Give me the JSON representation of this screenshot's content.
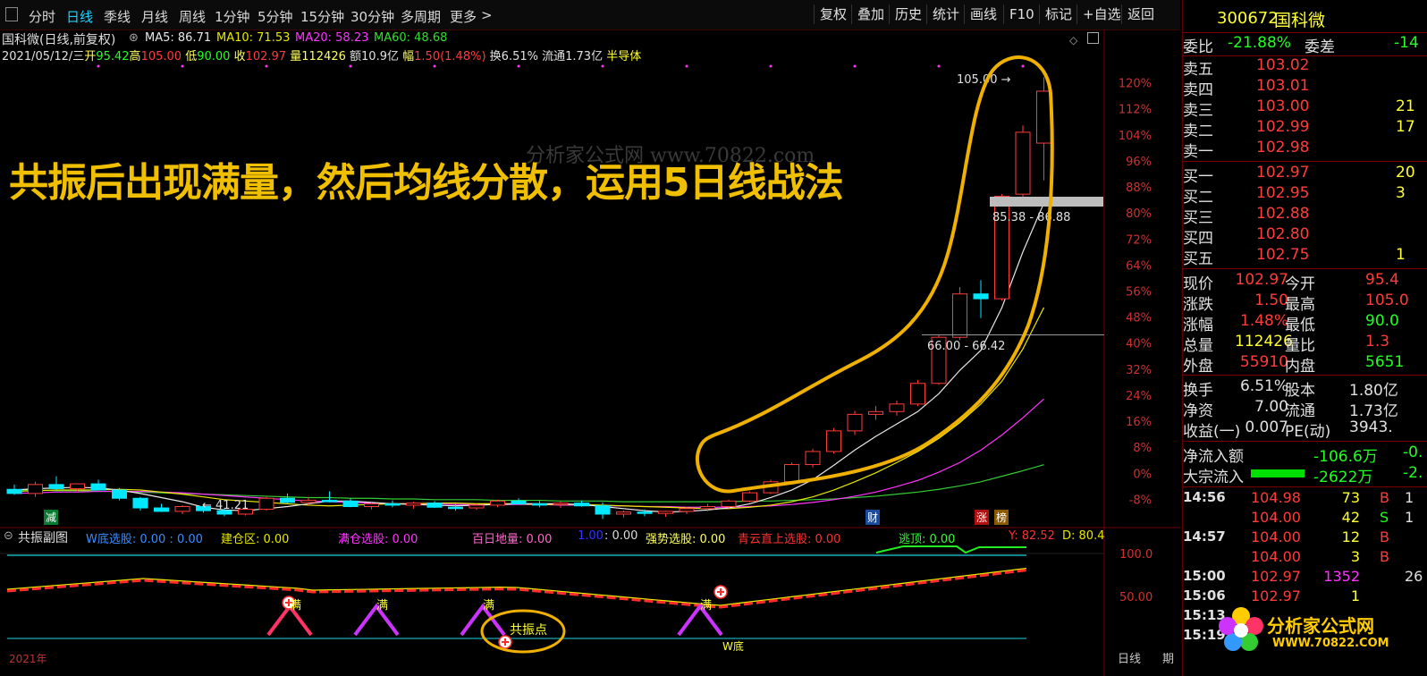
{
  "toolbar": {
    "tabs": [
      {
        "label": "分时",
        "active": false
      },
      {
        "label": "日线",
        "active": true
      },
      {
        "label": "季线",
        "active": false
      },
      {
        "label": "月线",
        "active": false
      },
      {
        "label": "周线",
        "active": false
      },
      {
        "label": "1分钟",
        "active": false
      },
      {
        "label": "5分钟",
        "active": false
      },
      {
        "label": "15分钟",
        "active": false
      },
      {
        "label": "30分钟",
        "active": false
      },
      {
        "label": "多周期",
        "active": false
      },
      {
        "label": "更多",
        "active": false
      }
    ],
    "more_arrow": ">",
    "right_buttons": [
      "复权",
      "叠加",
      "历史",
      "统计",
      "画线",
      "F10",
      "标记",
      "+自选",
      "返回"
    ]
  },
  "chart_header": {
    "name": "国科微(日线,前复权)",
    "ma5": "MA5: 86.71",
    "ma10": "MA10: 71.53",
    "ma20": "MA20: 58.23",
    "ma60": "MA60: 48.68",
    "date": "2021/05/12/三",
    "open_l": "开",
    "open": "95.42",
    "high_l": "高",
    "high": "105.00",
    "low_l": "低",
    "low": "90.00",
    "close_l": "收",
    "close": "102.97",
    "vol_l": "量",
    "vol": "112426",
    "amt": "额10.9亿",
    "chg_l": "幅",
    "chg": "1.50(1.48%)",
    "turnover": "换6.51%",
    "float": "流通1.73亿",
    "sector": "半导体"
  },
  "annotation": {
    "headline": "共振后出现满量，然后均线分散，运用5日线战法",
    "watermark": "分析家公式网 www.70822.com",
    "circle_label": "共振点"
  },
  "price_labels": {
    "high_mark": "105.00",
    "low_mark": "41.21",
    "range1": "85.38 - 86.88",
    "range2": "66.00 - 66.42"
  },
  "chart_data": {
    "type": "candlestick",
    "y_pct_ticks": [
      "120%",
      "112%",
      "104%",
      "96%",
      "88%",
      "80%",
      "72%",
      "64%",
      "56%",
      "48%",
      "40%",
      "32%",
      "24%",
      "16%",
      "8%",
      "0%",
      "-8%"
    ],
    "candles": [
      [
        45.1,
        45.8,
        44.3,
        44.5
      ],
      [
        44.5,
        46.2,
        44.0,
        45.8
      ],
      [
        45.8,
        47.0,
        45.0,
        45.2
      ],
      [
        45.2,
        46.0,
        44.8,
        45.9
      ],
      [
        45.9,
        46.5,
        45.0,
        45.0
      ],
      [
        45.0,
        45.3,
        43.5,
        43.8
      ],
      [
        43.8,
        44.0,
        42.0,
        42.4
      ],
      [
        42.4,
        43.0,
        41.8,
        41.9
      ],
      [
        41.9,
        42.8,
        41.5,
        42.6
      ],
      [
        42.6,
        43.0,
        41.7,
        42.0
      ],
      [
        42.0,
        42.3,
        41.2,
        41.5
      ],
      [
        41.5,
        42.4,
        41.3,
        42.2
      ],
      [
        42.2,
        44.0,
        42.0,
        43.8
      ],
      [
        43.8,
        44.5,
        43.0,
        43.2
      ],
      [
        43.2,
        44.0,
        42.8,
        43.5
      ],
      [
        43.5,
        44.8,
        43.2,
        43.4
      ],
      [
        43.4,
        43.8,
        42.5,
        42.6
      ],
      [
        42.6,
        43.2,
        42.2,
        43.0
      ],
      [
        43.0,
        43.5,
        42.5,
        42.8
      ],
      [
        42.8,
        43.3,
        42.3,
        43.1
      ],
      [
        43.1,
        43.4,
        42.4,
        42.5
      ],
      [
        42.5,
        43.0,
        42.0,
        42.4
      ],
      [
        42.4,
        43.0,
        42.1,
        42.8
      ],
      [
        42.8,
        43.6,
        42.5,
        43.4
      ],
      [
        43.4,
        43.8,
        42.9,
        43.0
      ],
      [
        43.0,
        43.4,
        42.5,
        42.9
      ],
      [
        42.9,
        43.3,
        42.4,
        43.1
      ],
      [
        43.1,
        43.5,
        42.6,
        42.7
      ],
      [
        42.7,
        43.2,
        40.8,
        41.5
      ],
      [
        41.5,
        42.0,
        41.0,
        41.8
      ],
      [
        41.8,
        42.2,
        41.2,
        41.6
      ],
      [
        41.6,
        42.0,
        41.1,
        41.9
      ],
      [
        41.9,
        42.5,
        41.5,
        42.3
      ],
      [
        42.3,
        43.0,
        41.9,
        42.6
      ],
      [
        42.6,
        43.6,
        42.3,
        43.4
      ],
      [
        43.4,
        44.8,
        43.2,
        44.6
      ],
      [
        44.6,
        46.5,
        44.4,
        46.2
      ],
      [
        46.2,
        49.0,
        46.0,
        48.7
      ],
      [
        48.7,
        51.0,
        48.3,
        50.6
      ],
      [
        50.6,
        54.0,
        50.3,
        53.6
      ],
      [
        53.6,
        56.5,
        53.0,
        56.0
      ],
      [
        56.0,
        57.2,
        55.2,
        56.4
      ],
      [
        56.4,
        58.0,
        55.8,
        57.5
      ],
      [
        57.5,
        61.0,
        57.2,
        60.5
      ],
      [
        60.5,
        67.5,
        60.3,
        67.2
      ],
      [
        67.2,
        74.5,
        66.8,
        73.5
      ],
      [
        73.5,
        75.5,
        70.0,
        72.8
      ],
      [
        72.8,
        88.0,
        72.5,
        87.7
      ],
      [
        88.0,
        98.0,
        87.5,
        97.0
      ],
      [
        95.42,
        105.0,
        90.0,
        102.97
      ]
    ],
    "ma5": [
      45.0,
      45.2,
      45.3,
      45.4,
      45.3,
      45.0,
      44.5,
      43.9,
      43.3,
      42.5,
      42.1,
      42.0,
      42.3,
      42.6,
      43.0,
      43.4,
      43.4,
      43.2,
      43.0,
      42.9,
      42.8,
      42.7,
      42.8,
      42.9,
      43.0,
      43.0,
      43.0,
      42.9,
      42.6,
      42.3,
      42.0,
      41.8,
      41.9,
      42.1,
      42.4,
      43.0,
      43.9,
      45.0,
      46.5,
      48.6,
      50.8,
      52.8,
      54.6,
      56.4,
      59.0,
      62.4,
      65.3,
      71.5,
      79.6,
      86.71
    ],
    "ma10": [
      44.8,
      44.9,
      45.0,
      45.0,
      45.0,
      45.1,
      45.0,
      44.7,
      44.4,
      44.0,
      43.6,
      43.4,
      43.2,
      43.0,
      42.8,
      42.7,
      42.8,
      42.9,
      43.0,
      43.0,
      43.1,
      43.1,
      43.0,
      43.0,
      43.0,
      42.9,
      42.9,
      42.9,
      42.8,
      42.7,
      42.6,
      42.5,
      42.4,
      42.3,
      42.3,
      42.5,
      42.8,
      43.3,
      44.0,
      45.0,
      46.2,
      47.5,
      49.0,
      50.6,
      52.5,
      54.8,
      57.5,
      60.8,
      65.5,
      71.53
    ],
    "ma20": [
      44.5,
      44.6,
      44.7,
      44.7,
      44.8,
      44.8,
      44.8,
      44.7,
      44.6,
      44.4,
      44.2,
      44.0,
      43.8,
      43.6,
      43.4,
      43.3,
      43.2,
      43.1,
      43.0,
      43.0,
      43.0,
      42.9,
      42.9,
      42.9,
      42.9,
      42.9,
      42.8,
      42.8,
      42.7,
      42.7,
      42.6,
      42.6,
      42.5,
      42.5,
      42.5,
      42.6,
      42.7,
      42.9,
      43.2,
      43.6,
      44.1,
      44.7,
      45.5,
      46.4,
      47.6,
      49.0,
      50.8,
      53.0,
      55.5,
      58.23
    ],
    "ma60": [
      45.0,
      45.0,
      44.9,
      44.9,
      44.8,
      44.8,
      44.7,
      44.6,
      44.5,
      44.4,
      44.3,
      44.2,
      44.1,
      44.0,
      43.9,
      43.9,
      43.8,
      43.8,
      43.7,
      43.7,
      43.6,
      43.6,
      43.6,
      43.5,
      43.5,
      43.5,
      43.4,
      43.4,
      43.4,
      43.3,
      43.3,
      43.3,
      43.3,
      43.3,
      43.3,
      43.4,
      43.4,
      43.5,
      43.6,
      43.7,
      43.9,
      44.1,
      44.4,
      44.7,
      45.1,
      45.6,
      46.2,
      47.0,
      47.8,
      48.68
    ]
  },
  "sub_chart": {
    "title": "共振副图",
    "items": [
      {
        "label": "W底选股: 0.00  : 0.00",
        "color": "#3a8cff"
      },
      {
        "label": "建仓区: 0.00",
        "color": "#e8e800"
      },
      {
        "label": "满仓选股: 0.00",
        "color": "#ff33ff"
      },
      {
        "label": "百日地量: 0.00",
        "color": "#ff66cc"
      },
      {
        "label": "1.00",
        "color": "#3333ff"
      },
      {
        "label": ": 0.00",
        "color": "#dddddd"
      },
      {
        "label": "强势选股: 0.00",
        "color": "#ffff66"
      },
      {
        "label": "青云直上选股: 0.00",
        "color": "#ff3030"
      },
      {
        "label": "逃顶: 0.00",
        "color": "#33ff33"
      },
      {
        "label": "Y: 82.52",
        "color": "#ff3030"
      },
      {
        "label": "D: 80.4",
        "color": "#e8e800"
      }
    ],
    "y_ticks": [
      "100.0",
      "50.00"
    ],
    "marks": [
      "满",
      "满",
      "满",
      "满"
    ],
    "labels": [
      "减",
      "财",
      "涨",
      "榜",
      "W底",
      "2021年",
      "日线",
      "期"
    ]
  },
  "quote_panel": {
    "code": "300672",
    "name": "国科微",
    "weibi_l": "委比",
    "weibi": "-21.88%",
    "weicha_l": "委差",
    "weicha": "-14",
    "asks": [
      {
        "label": "卖五",
        "price": "103.02",
        "vol": ""
      },
      {
        "label": "卖四",
        "price": "103.01",
        "vol": ""
      },
      {
        "label": "卖三",
        "price": "103.00",
        "vol": "21"
      },
      {
        "label": "卖二",
        "price": "102.99",
        "vol": "17"
      },
      {
        "label": "卖一",
        "price": "102.98",
        "vol": ""
      }
    ],
    "bids": [
      {
        "label": "买一",
        "price": "102.97",
        "vol": "20"
      },
      {
        "label": "买二",
        "price": "102.95",
        "vol": "3"
      },
      {
        "label": "买三",
        "price": "102.88",
        "vol": ""
      },
      {
        "label": "买四",
        "price": "102.80",
        "vol": ""
      },
      {
        "label": "买五",
        "price": "102.75",
        "vol": "1"
      }
    ],
    "stats": [
      {
        "l1": "现价",
        "v1": "102.97",
        "c1": "#ff3b3b",
        "l2": "今开",
        "v2": "95.4",
        "c2": "#ff3b3b"
      },
      {
        "l1": "涨跌",
        "v1": "1.50",
        "c1": "#ff3b3b",
        "l2": "最高",
        "v2": "105.0",
        "c2": "#ff3b3b"
      },
      {
        "l1": "涨幅",
        "v1": "1.48%",
        "c1": "#ff3b3b",
        "l2": "最低",
        "v2": "90.0",
        "c2": "#21ff21"
      },
      {
        "l1": "总量",
        "v1": "112426",
        "c1": "#ffff33",
        "l2": "量比",
        "v2": "1.3",
        "c2": "#ff3b3b"
      },
      {
        "l1": "外盘",
        "v1": "55910",
        "c1": "#ff3b3b",
        "l2": "内盘",
        "v2": "5651",
        "c2": "#21ff21"
      }
    ],
    "stats2": [
      {
        "l1": "换手",
        "v1": "6.51%",
        "l2": "股本",
        "v2": "1.80亿"
      },
      {
        "l1": "净资",
        "v1": "7.00",
        "l2": "流通",
        "v2": "1.73亿"
      },
      {
        "l1": "收益(一)",
        "v1": "0.007",
        "l2": "PE(动)",
        "v2": "3943."
      }
    ],
    "flows": [
      {
        "label": "净流入额",
        "value": "-106.6万",
        "extra": "-0."
      },
      {
        "label": "大宗流入",
        "value": "-2622万",
        "extra": "-2."
      }
    ],
    "ticks": [
      {
        "time": "14:56",
        "price": "104.98",
        "vol": "73",
        "side": "B",
        "x": "1"
      },
      {
        "time": "",
        "price": "104.00",
        "vol": "42",
        "side": "S",
        "x": "1"
      },
      {
        "time": "14:57",
        "price": "104.00",
        "vol": "12",
        "side": "B",
        "x": ""
      },
      {
        "time": "",
        "price": "104.00",
        "vol": "3",
        "side": "B",
        "x": ""
      },
      {
        "time": "15:00",
        "price": "102.97",
        "vol": "1352",
        "side": "",
        "x": "26"
      },
      {
        "time": "15:06",
        "price": "102.97",
        "vol": "1",
        "side": "",
        "x": ""
      },
      {
        "time": "15:13",
        "price": "",
        "vol": "",
        "side": "",
        "x": ""
      },
      {
        "time": "15:19",
        "price": "",
        "vol": "",
        "side": "",
        "x": ""
      }
    ],
    "logo_text": "分析家公式网",
    "logo_url": "WWW.70822.COM"
  },
  "colors": {
    "up": "#ff3b3b",
    "down": "#00e8ff",
    "ma5": "#e8e8e8",
    "ma10": "#e8e800",
    "ma20": "#ff33ff",
    "ma60": "#33cc33",
    "accent": "#f0a800"
  }
}
